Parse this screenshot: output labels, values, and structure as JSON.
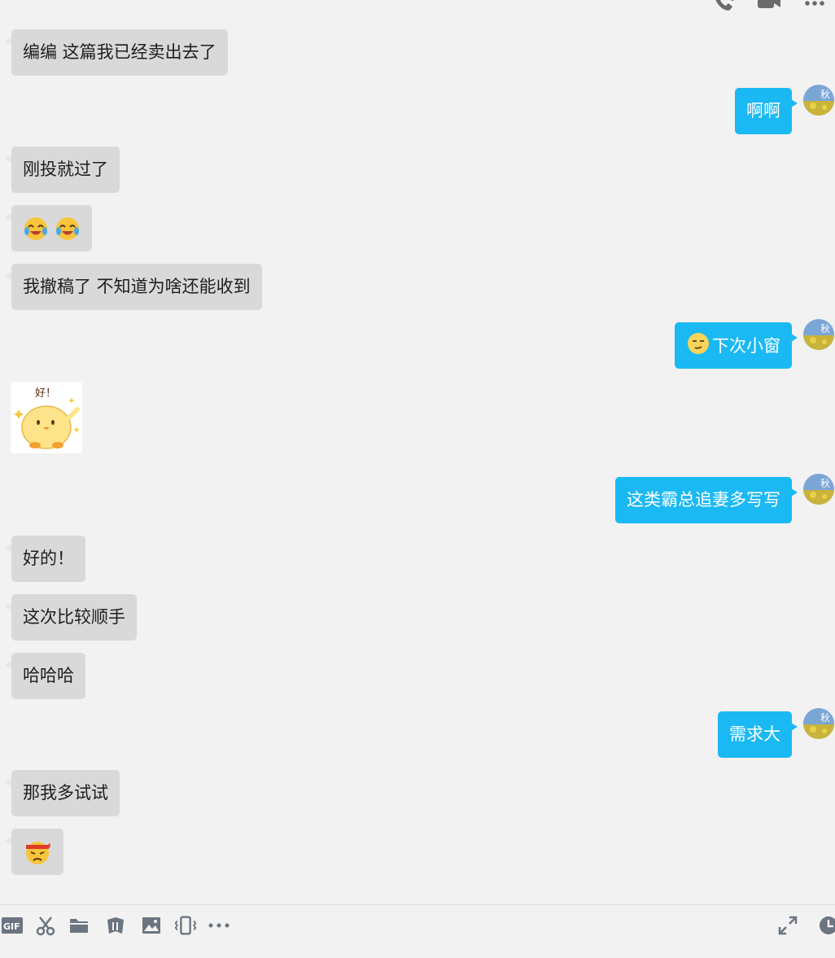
{
  "header": {
    "icons": [
      "voice-call-icon",
      "video-call-icon",
      "more-icon"
    ]
  },
  "messages": [
    {
      "side": "left",
      "text": "编编 这篇我已经卖出去了"
    },
    {
      "side": "right",
      "text": "啊啊"
    },
    {
      "side": "left",
      "text": "刚投就过了"
    },
    {
      "side": "left",
      "emoji": [
        "crying-laughing-emoji",
        "crying-laughing-emoji"
      ]
    },
    {
      "side": "left",
      "text": "我撤稿了 不知道为啥还能收到"
    },
    {
      "side": "right",
      "text": "下次小窗",
      "emoji": [
        "smirk-emoji"
      ]
    },
    {
      "side": "left",
      "sticker": {
        "name": "chick-sticker",
        "caption": "好！"
      }
    },
    {
      "side": "right",
      "text": "这类霸总追妻多写写"
    },
    {
      "side": "left",
      "text": "好的！"
    },
    {
      "side": "left",
      "text": "这次比较顺手"
    },
    {
      "side": "left",
      "text": "哈哈哈"
    },
    {
      "side": "right",
      "text": "需求大"
    },
    {
      "side": "left",
      "text": "那我多试试"
    },
    {
      "side": "left",
      "emoji": [
        "determined-headband-emoji"
      ]
    }
  ],
  "toolbar": {
    "gif_label": "GIF",
    "icons": [
      "gif-icon",
      "scissors-icon",
      "folder-icon",
      "screenshot-icon",
      "image-icon",
      "shake-icon",
      "more-icon"
    ],
    "right_icons": [
      "expand-icon",
      "history-icon"
    ]
  },
  "colors": {
    "background": "#f2f2f2",
    "left_bubble": "#d9d9d9",
    "right_bubble": "#1bb9f3"
  }
}
